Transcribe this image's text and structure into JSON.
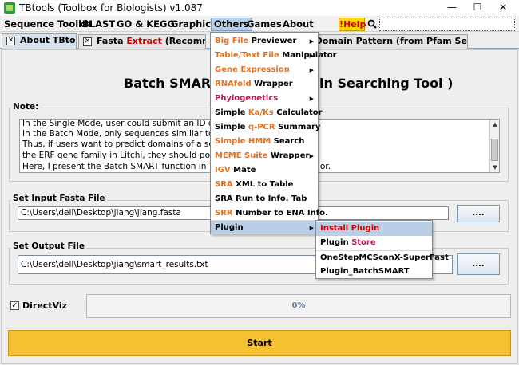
{
  "window": {
    "title": "TBtools (Toolbox for Biologists) v1.087",
    "controls": {
      "minimize": "—",
      "maximize": "☐",
      "close": "✕"
    }
  },
  "menubar": {
    "items": [
      "Sequence Toolkit",
      "BLAST",
      "GO & KEGG",
      "Graphics",
      "Others",
      "Games",
      "About"
    ],
    "active": "Others",
    "help": "!Help"
  },
  "tabs": [
    {
      "label": "About TBtools"
    },
    {
      "label_plain": "Fasta ",
      "label_red": "Extract",
      "label_tail": " (Recommended)"
    },
    {
      "label": "alize Domain Pattern (from Pfam Search)"
    }
  ],
  "main": {
    "title": "Batch SMART",
    "title_tail": "in Searching Tool )",
    "note_label": "Note:",
    "note_lines": [
      "In the Single Mode, user could submit an ID or a sequen",
      "In the Batch Mode, only sequences similiar to those stor",
      "Thus, if users want to predict domains of a set of protein",
      " the ERF gene family in Litchi, they should post these se",
      "Here, I present the Batch SMART function in TBtools. And"
    ],
    "note_tail": "or.",
    "input_label": "Set Input Fasta File",
    "input_value": "C:\\Users\\dell\\Desktop\\jiang\\jiang.fasta",
    "output_label": "Set Output File",
    "output_value": "C:\\Users\\dell\\Desktop\\jiang\\smart_results.txt",
    "browse_label": "....",
    "directviz_label": "DirectViz",
    "progress": 0,
    "progress_text": "0%",
    "start_label": "Start"
  },
  "others_menu": [
    {
      "a": "Big File",
      "b": " Previewer",
      "c": "o",
      "arrow": true
    },
    {
      "a": "Table/Text File",
      "b": " Manipulator",
      "c": "o",
      "arrow": true
    },
    {
      "a": "Gene Expression",
      "b": "",
      "c": "o",
      "arrow": true
    },
    {
      "a": "RNAfold",
      "b": " Wrapper",
      "c": "o",
      "arrow": false
    },
    {
      "a": "",
      "b": "Phylogenetics",
      "c": "o",
      "arrow": true
    },
    {
      "a": "Simple ",
      "b": "Ka/Ks",
      "b2": " Calculator",
      "c": "o",
      "arrow": false
    },
    {
      "a": "Simple ",
      "b": "q-PCR",
      "b2": " Summary",
      "c": "o",
      "arrow": false
    },
    {
      "a": "Simple HMM",
      "b": " Search",
      "c": "o",
      "arrow": false
    },
    {
      "a": "MEME Suite",
      "b": " Wrapper",
      "c": "o",
      "arrow": true
    },
    {
      "a": "IGV",
      "b": " Mate",
      "c": "o",
      "arrow": false
    },
    {
      "a": "SRA",
      "b": " XML to Table",
      "c": "o",
      "arrow": false
    },
    {
      "a": "",
      "b": "SRA Run to Info. Tab",
      "c": "o",
      "arrow": false
    },
    {
      "a": "SRR",
      "b": " Number to ENA Info.",
      "c": "o",
      "arrow": false
    },
    {
      "a": "",
      "b": "Plugin",
      "c": "o",
      "arrow": true
    }
  ],
  "plugin_menu": [
    {
      "a": "Install",
      "b": " Plugin"
    },
    {
      "a": "Plugin ",
      "b": "Store"
    },
    {
      "a": "",
      "b": "OneStepMCScanX-SuperFast"
    },
    {
      "a": "",
      "b": "Plugin_BatchSMART"
    }
  ],
  "colors": {
    "accent": "#e8701a",
    "highlight": "#b8cfe5",
    "start": "#f5c133",
    "help": "#ffd700"
  }
}
